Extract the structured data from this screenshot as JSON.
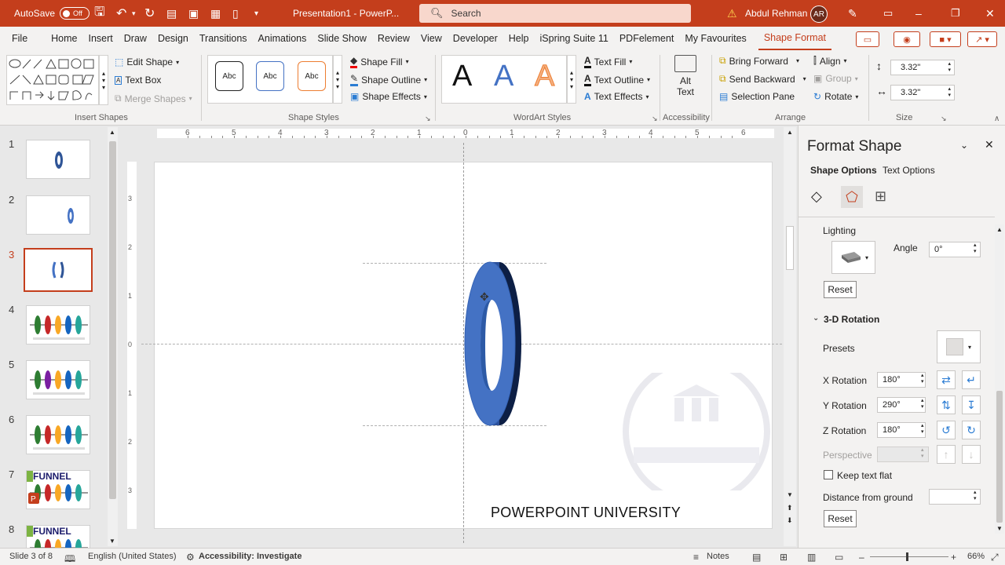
{
  "titlebar": {
    "autosave_label": "AutoSave",
    "autosave_state": "Off",
    "doc_title": "Presentation1 - PowerP...",
    "search_placeholder": "Search",
    "user_name": "Abdul Rehman",
    "user_initials": "AR",
    "bg_color": "#c43e1c"
  },
  "tabs": [
    "File",
    "Home",
    "Insert",
    "Draw",
    "Design",
    "Transitions",
    "Animations",
    "Slide Show",
    "Review",
    "View",
    "Developer",
    "Help",
    "iSpring Suite 11",
    "PDFelement",
    "My Favourites",
    "Shape Format"
  ],
  "active_tab": "Shape Format",
  "ribbon": {
    "insert_shapes": {
      "label": "Insert Shapes",
      "edit_shape": "Edit Shape",
      "text_box": "Text Box",
      "merge_shapes": "Merge Shapes"
    },
    "shape_styles": {
      "label": "Shape Styles",
      "sample": "Abc",
      "shape_fill": "Shape Fill",
      "shape_outline": "Shape Outline",
      "shape_effects": "Shape Effects"
    },
    "wordart_styles": {
      "label": "WordArt Styles",
      "sample": "A",
      "text_fill": "Text Fill",
      "text_outline": "Text Outline",
      "text_effects": "Text Effects"
    },
    "accessibility": {
      "label": "Accessibility",
      "alt_text_1": "Alt",
      "alt_text_2": "Text"
    },
    "arrange": {
      "label": "Arrange",
      "bring_forward": "Bring Forward",
      "send_backward": "Send Backward",
      "selection_pane": "Selection Pane",
      "align": "Align",
      "group": "Group",
      "rotate": "Rotate"
    },
    "size": {
      "label": "Size",
      "height": "3.32\"",
      "width": "3.32\""
    }
  },
  "slides": [
    {
      "num": "1"
    },
    {
      "num": "2"
    },
    {
      "num": "3"
    },
    {
      "num": "4"
    },
    {
      "num": "5"
    },
    {
      "num": "6"
    },
    {
      "num": "7",
      "thumb_text": "FUNNEL"
    },
    {
      "num": "8",
      "thumb_text": "FUNNEL"
    }
  ],
  "selected_slide": "3",
  "slide_content": {
    "watermark_text": "POWERPOINT UNIVERSITY",
    "shape_color": "#4472c4"
  },
  "ruler": {
    "h_ticks": [
      "6",
      "5",
      "4",
      "3",
      "2",
      "1",
      "0",
      "1",
      "2",
      "3",
      "4",
      "5",
      "6"
    ],
    "v_ticks": [
      "3",
      "2",
      "1",
      "0",
      "1",
      "2",
      "3"
    ]
  },
  "format_pane": {
    "title": "Format Shape",
    "tab_shape_options": "Shape Options",
    "tab_text_options": "Text Options",
    "lighting_label": "Lighting",
    "angle_label": "Angle",
    "angle_value": "0°",
    "reset_label": "Reset",
    "rotation_section": "3-D Rotation",
    "presets_label": "Presets",
    "x_rotation_label": "X Rotation",
    "x_rotation_value": "180°",
    "y_rotation_label": "Y Rotation",
    "y_rotation_value": "290°",
    "z_rotation_label": "Z Rotation",
    "z_rotation_value": "180°",
    "perspective_label": "Perspective",
    "keep_text_flat_label": "Keep text flat",
    "distance_label": "Distance from ground"
  },
  "status": {
    "slide_of": "Slide 3 of 8",
    "language": "English (United States)",
    "accessibility": "Accessibility: Investigate",
    "notes": "Notes",
    "zoom": "66%"
  }
}
